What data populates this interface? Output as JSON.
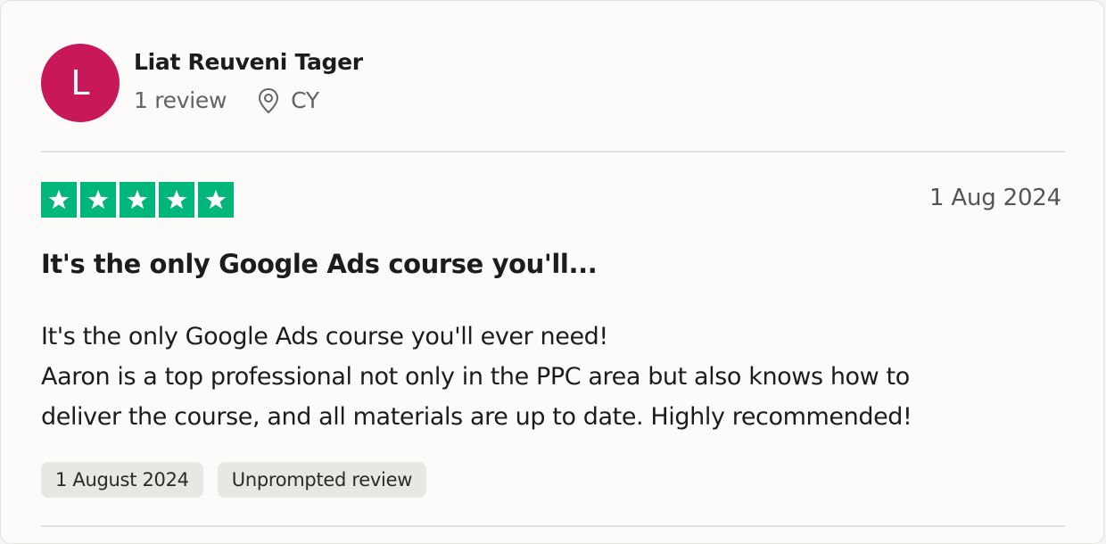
{
  "reviewer": {
    "initial": "L",
    "name": "Liat Reuveni Tager",
    "review_count": "1 review",
    "location_icon": "location-pin-icon",
    "country": "CY",
    "avatar_color": "#c8185a"
  },
  "review": {
    "rating": 5,
    "max_rating": 5,
    "star_color": "#00b67a",
    "date": "1 Aug 2024",
    "title": "It's the only Google Ads course you'll...",
    "body_lines": [
      "It's the only Google Ads course you'll ever need!",
      "Aaron is a top professional not only in the PPC area but also knows how to",
      "deliver the course, and all materials are up to date. Highly recommended!"
    ],
    "tags": [
      "1 August 2024",
      "Unprompted review"
    ]
  }
}
